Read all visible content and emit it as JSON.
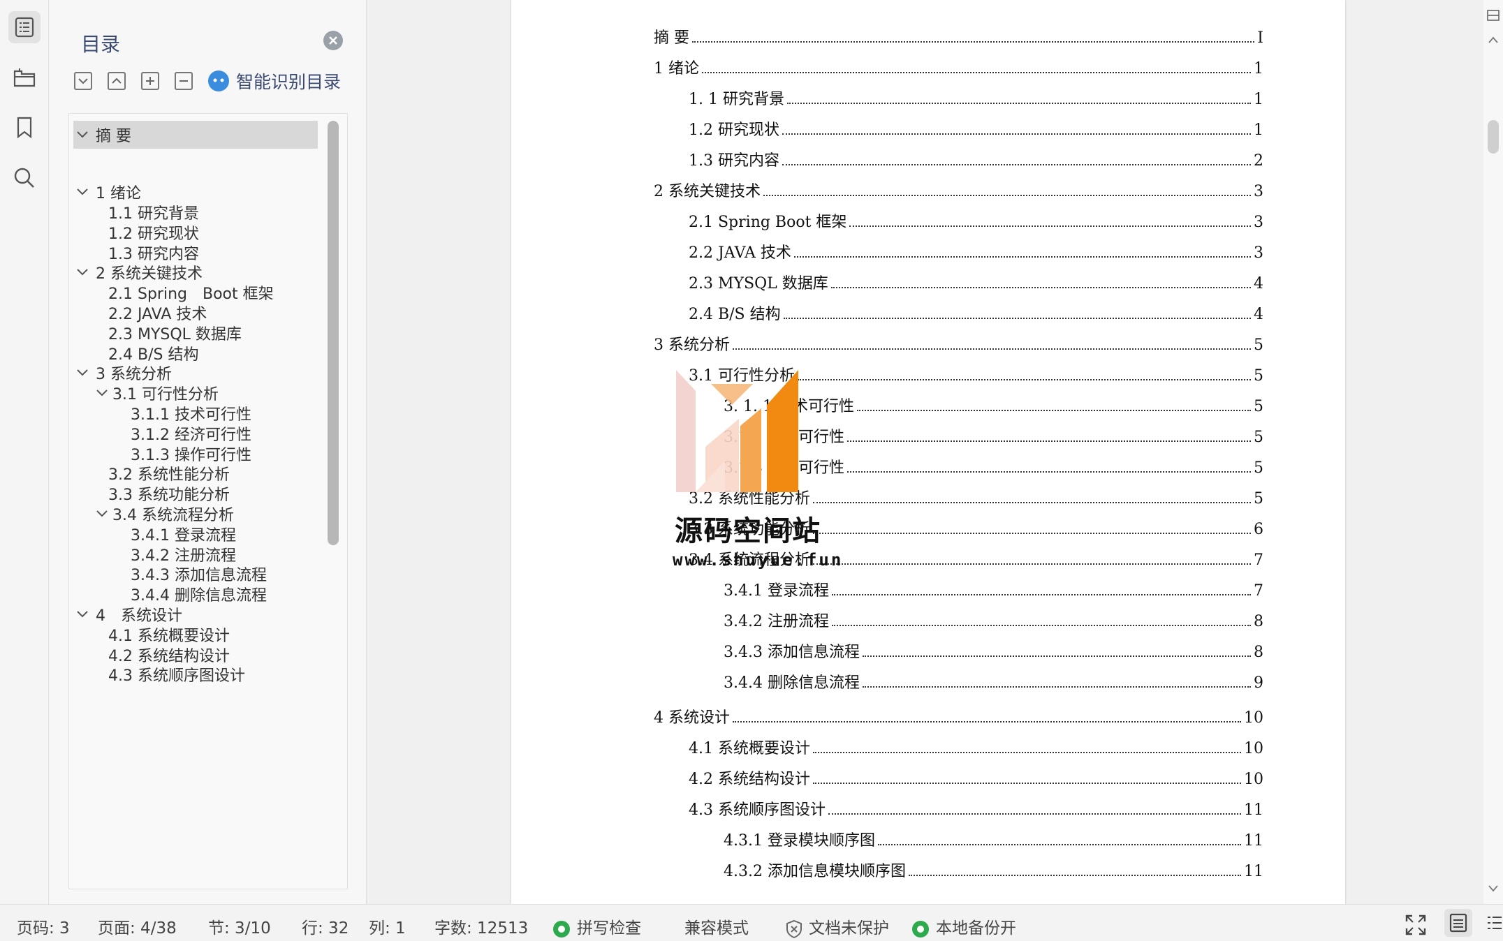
{
  "rail": {
    "icons": [
      "toc-icon",
      "navigation-pane-icon",
      "bookmark-icon",
      "search-icon"
    ]
  },
  "toc_panel": {
    "title": "目录",
    "smart_label": "智能识别目录",
    "items": [
      {
        "label": "摘 要",
        "level": 0,
        "expanded": true
      },
      {
        "label": "1 绪论",
        "level": 0,
        "expanded": true
      },
      {
        "label": "1.1 研究背景",
        "level": 1
      },
      {
        "label": "1.2 研究现状",
        "level": 1
      },
      {
        "label": "1.3 研究内容",
        "level": 1
      },
      {
        "label": "2 系统关键技术",
        "level": 0,
        "expanded": true
      },
      {
        "label": "2.1 Spring　Boot 框架",
        "level": 1
      },
      {
        "label": "2.2 JAVA 技术",
        "level": 1
      },
      {
        "label": "2.3 MYSQL 数据库",
        "level": 1
      },
      {
        "label": "2.4 B/S 结构",
        "level": 1
      },
      {
        "label": "3 系统分析",
        "level": 0,
        "expanded": true
      },
      {
        "label": "3.1 可行性分析",
        "level": 1,
        "expanded": true
      },
      {
        "label": "3.1.1 技术可行性",
        "level": 2
      },
      {
        "label": "3.1.2 经济可行性",
        "level": 2
      },
      {
        "label": "3.1.3 操作可行性",
        "level": 2
      },
      {
        "label": "3.2 系统性能分析",
        "level": 1
      },
      {
        "label": "3.3 系统功能分析",
        "level": 1
      },
      {
        "label": "3.4 系统流程分析",
        "level": 1,
        "expanded": true
      },
      {
        "label": "3.4.1 登录流程",
        "level": 2
      },
      {
        "label": "3.4.2 注册流程",
        "level": 2
      },
      {
        "label": "3.4.3 添加信息流程",
        "level": 2
      },
      {
        "label": "3.4.4 删除信息流程",
        "level": 2
      },
      {
        "label": "4　系统设计",
        "level": 0,
        "expanded": true
      },
      {
        "label": "4.1 系统概要设计",
        "level": 1
      },
      {
        "label": "4.2 系统结构设计",
        "level": 1
      },
      {
        "label": "4.3 系统顺序图设计",
        "level": 1
      }
    ]
  },
  "document": {
    "toc_entries": [
      {
        "label": "摘  要",
        "page": "I",
        "indent": 0
      },
      {
        "label": "1  绪论",
        "page": "1",
        "indent": 0
      },
      {
        "label": "1. 1 研究背景",
        "page": "1",
        "indent": 1
      },
      {
        "label": "1.2 研究现状",
        "page": "1",
        "indent": 1
      },
      {
        "label": "1.3 研究内容",
        "page": "2",
        "indent": 1
      },
      {
        "label": "2  系统关键技术",
        "page": "3",
        "indent": 0
      },
      {
        "label": "2.1 Spring Boot 框架",
        "page": "3",
        "indent": 1
      },
      {
        "label": "2.2 JAVA 技术",
        "page": "3",
        "indent": 1
      },
      {
        "label": "2.3 MYSQL 数据库",
        "page": "4",
        "indent": 1
      },
      {
        "label": "2.4 B/S 结构",
        "page": "4",
        "indent": 1
      },
      {
        "label": "3  系统分析",
        "page": "5",
        "indent": 0
      },
      {
        "label": "3.1  可行性分析",
        "page": "5",
        "indent": 1
      },
      {
        "label": "3. 1. 1  技术可行性",
        "page": "5",
        "indent": 2
      },
      {
        "label": "3.1.2 经济可行性",
        "page": "5",
        "indent": 2
      },
      {
        "label": "3.1.3 操作可行性",
        "page": "5",
        "indent": 2
      },
      {
        "label": "3.2  系统性能分析",
        "page": "5",
        "indent": 1
      },
      {
        "label": "3.3  系统功能分析",
        "page": "6",
        "indent": 1
      },
      {
        "label": "3.4 系统流程分析",
        "page": "7",
        "indent": 1
      },
      {
        "label": "3.4.1 登录流程",
        "page": "7",
        "indent": 2
      },
      {
        "label": "3.4.2 注册流程",
        "page": "8",
        "indent": 2
      },
      {
        "label": "3.4.3 添加信息流程",
        "page": "8",
        "indent": 2
      },
      {
        "label": "3.4.4 删除信息流程",
        "page": "9",
        "indent": 2
      },
      {
        "label": "4    系统设计",
        "page": "10",
        "indent": 0
      },
      {
        "label": "4.1 系统概要设计",
        "page": "10",
        "indent": 1
      },
      {
        "label": "4.2 系统结构设计",
        "page": "10",
        "indent": 1
      },
      {
        "label": "4.3 系统顺序图设计",
        "page": "11",
        "indent": 1
      },
      {
        "label": "4.3.1 登录模块顺序图",
        "page": "11",
        "indent": 2
      },
      {
        "label": "4.3.2 添加信息模块顺序图",
        "page": "11",
        "indent": 2
      }
    ],
    "watermark": {
      "title": "源码空间站",
      "url": "www.shuyue.fun"
    }
  },
  "status_bar": {
    "page_code": "页码: 3",
    "page": "页面: 4/38",
    "section": "节: 3/10",
    "row": "行: 32",
    "col": "列: 1",
    "word_count": "字数: 12513",
    "spell_check": "拼写检查",
    "compat_mode": "兼容模式",
    "doc_protect": "文档未保护",
    "local_backup": "本地备份开"
  },
  "colors": {
    "accent_blue": "#3a8dde",
    "status_green": "#2eaa4e",
    "watermark_orange": "#f28a12"
  }
}
